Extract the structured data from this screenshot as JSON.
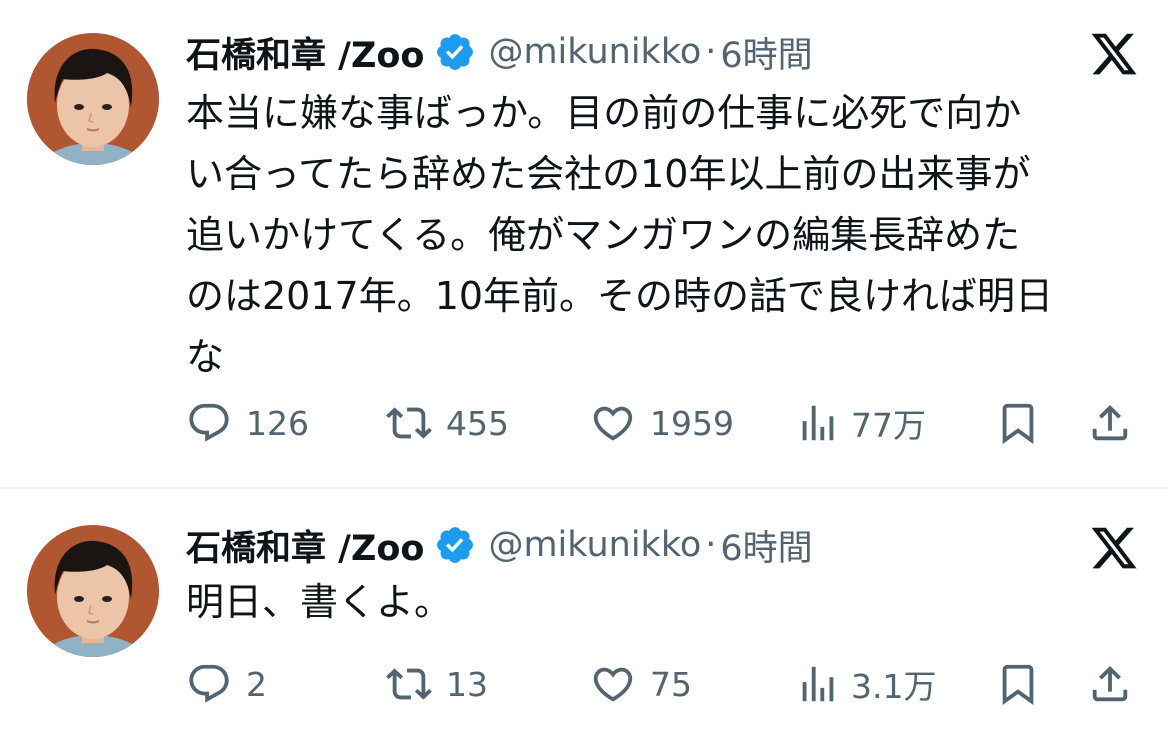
{
  "tweets": [
    {
      "display_name": "石橋和章 /Zoo",
      "handle": "@mikunikko",
      "separator": "·",
      "time": "6時間",
      "text_lines": [
        "本当に嫌な事ばっか。目の前の仕事に必死で向か",
        "い合ってたら辞めた会社の10年以上前の出来事が",
        "追いかけてくる。俺がマンガワンの編集長辞めた",
        "のは2017年。10年前。その時の話で良ければ明日",
        "な"
      ],
      "replies": "126",
      "retweets": "455",
      "likes": "1959",
      "views": "77万"
    },
    {
      "display_name": "石橋和章 /Zoo",
      "handle": "@mikunikko",
      "separator": "·",
      "time": "6時間",
      "text_lines": [
        "明日、書くよ。"
      ],
      "replies": "2",
      "retweets": "13",
      "likes": "75",
      "views": "3.1万"
    }
  ],
  "icons": {
    "verified": "verified-badge-icon",
    "platform": "x-logo-icon",
    "reply": "reply-icon",
    "retweet": "retweet-icon",
    "like": "heart-icon",
    "views": "views-icon",
    "bookmark": "bookmark-icon",
    "share": "share-icon"
  },
  "colors": {
    "text": "#0f1419",
    "secondary": "#536471",
    "verified": "#1d9bf0",
    "divider": "#eff3f4"
  }
}
